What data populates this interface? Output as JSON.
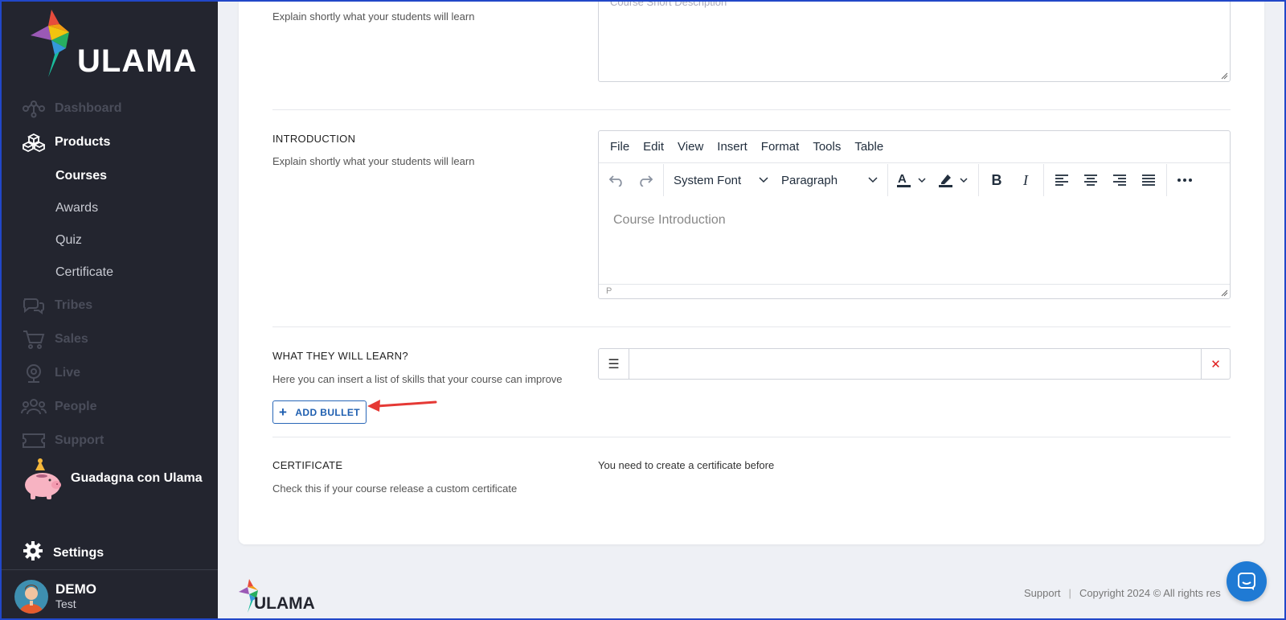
{
  "sidebar": {
    "brand": "ULAMA",
    "nav": [
      {
        "label": "Dashboard",
        "icon": "dashboard-icon"
      },
      {
        "label": "Products",
        "icon": "cubes-icon"
      },
      {
        "label": "Tribes",
        "icon": "chat-bubbles-icon"
      },
      {
        "label": "Sales",
        "icon": "cart-icon"
      },
      {
        "label": "Live",
        "icon": "webcam-icon"
      },
      {
        "label": "People",
        "icon": "people-icon"
      },
      {
        "label": "Support",
        "icon": "ticket-icon"
      }
    ],
    "products_sub": [
      {
        "label": "Courses"
      },
      {
        "label": "Awards"
      },
      {
        "label": "Quiz"
      },
      {
        "label": "Certificate"
      }
    ],
    "promo_label": "Guadagna con Ulama",
    "settings_label": "Settings",
    "user": {
      "name": "DEMO",
      "sub": "Test"
    }
  },
  "form": {
    "short_desc": {
      "description": "Explain shortly what your students will learn",
      "placeholder": "Course Short Description"
    },
    "introduction": {
      "label": "INTRODUCTION",
      "description": "Explain shortly what your students will learn",
      "menu": [
        "File",
        "Edit",
        "View",
        "Insert",
        "Format",
        "Tools",
        "Table"
      ],
      "font_select": "System Font",
      "block_select": "Paragraph",
      "placeholder": "Course Introduction",
      "status_path": "P"
    },
    "learn": {
      "label": "WHAT THEY WILL LEARN?",
      "description": "Here you can insert a list of skills that your course can improve",
      "add_button": "ADD BULLET"
    },
    "certificate": {
      "label": "CERTIFICATE",
      "description": "Check this if your course release a custom certificate",
      "note": "You need to create a certificate before"
    }
  },
  "footer": {
    "brand": "ULAMA",
    "support": "Support",
    "separator": "|",
    "copyright": "Copyright 2024 © All rights res"
  },
  "colors": {
    "sidebar_bg": "#23252f",
    "accent_blue": "#1f5fb0",
    "remove_red": "#e02020",
    "annotation_arrow": "#e53935"
  }
}
